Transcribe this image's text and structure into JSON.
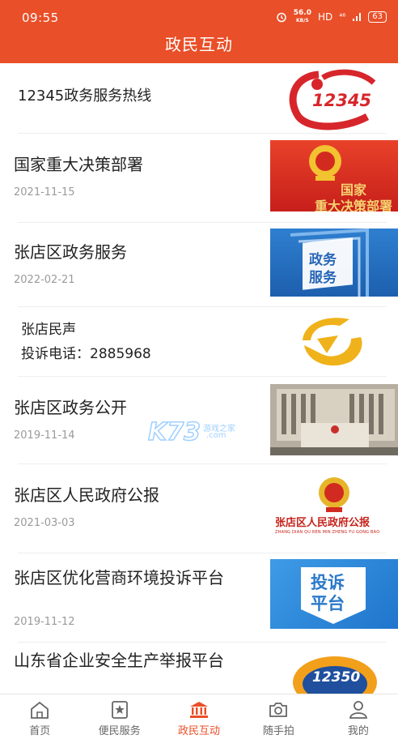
{
  "status_bar": {
    "time": "09:55",
    "speed_value": "56.0",
    "speed_unit": "KB/S",
    "hd": "HD",
    "network": "⁴⁶",
    "battery": "63"
  },
  "header": {
    "title": "政民互动"
  },
  "items": [
    {
      "title": "12345政务服务热线",
      "date": "",
      "thumb_text": "12345"
    },
    {
      "title": "国家重大决策部署",
      "date": "2021-11-15",
      "thumb_text": "国家\n重大决策部署"
    },
    {
      "title": "张店区政务服务",
      "date": "2022-02-21",
      "thumb_text": "政务\n服务"
    },
    {
      "title": "张店民声\n投诉电话：2885968",
      "date": "",
      "thumb_text": ""
    },
    {
      "title": "张店区政务公开",
      "date": "2019-11-14",
      "thumb_text": ""
    },
    {
      "title": "张店区人民政府公报",
      "date": "2021-03-03",
      "thumb_text": "张店区人民政府公报",
      "thumb_subtext": "ZHANG DIAN QU REN MIN ZHENG FU GONG BAO"
    },
    {
      "title": "张店区优化营商环境投诉平台",
      "date": "2019-11-12",
      "thumb_text": "投诉\n平台"
    },
    {
      "title": "山东省企业安全生产举报平台",
      "date": "",
      "thumb_text": "12350"
    }
  ],
  "watermark": {
    "text": "K73",
    "sub1": "游戏之家",
    "sub2": ".com"
  },
  "bottom_nav": [
    {
      "label": "首页",
      "icon": "home-icon",
      "active": false
    },
    {
      "label": "便民服务",
      "icon": "star-bookmark-icon",
      "active": false
    },
    {
      "label": "政民互动",
      "icon": "government-building-icon",
      "active": true
    },
    {
      "label": "随手拍",
      "icon": "camera-icon",
      "active": false
    },
    {
      "label": "我的",
      "icon": "user-icon",
      "active": false
    }
  ],
  "colors": {
    "brand": "#e94f28",
    "inactive": "#666666",
    "date": "#9a9a9a"
  }
}
